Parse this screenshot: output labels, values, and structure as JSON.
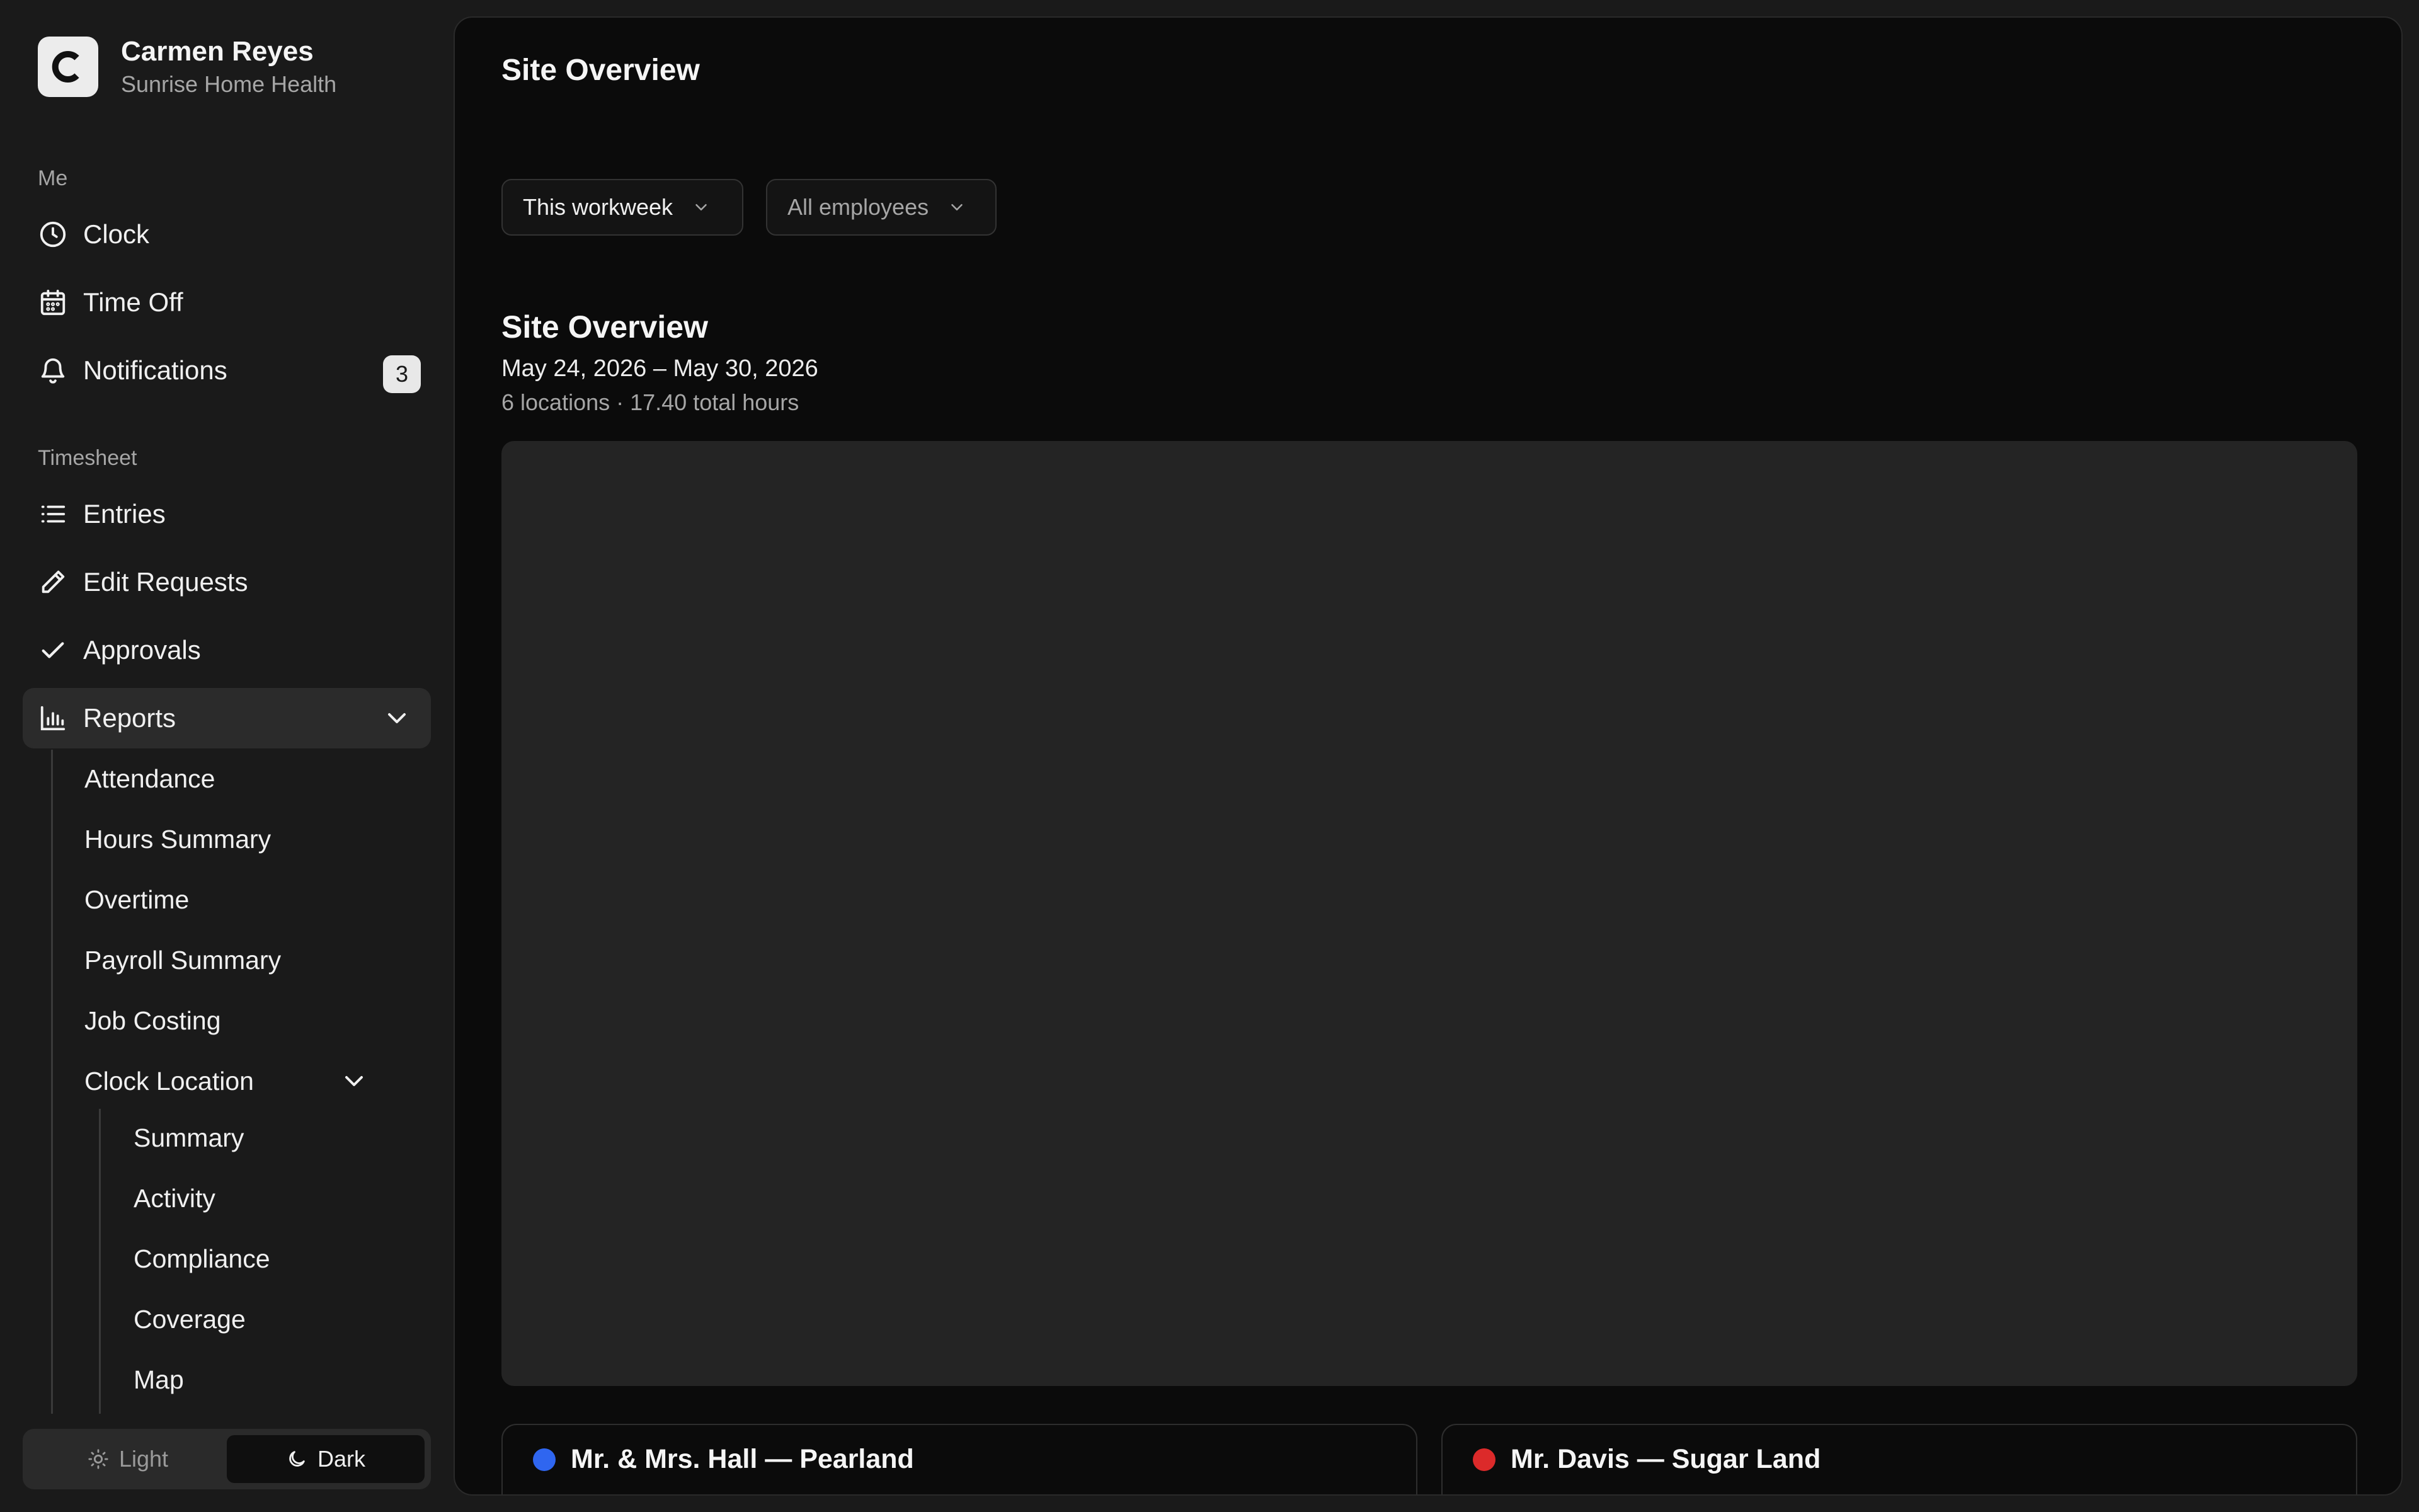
{
  "profile": {
    "name": "Carmen Reyes",
    "org": "Sunrise Home Health",
    "logo_letter": "C"
  },
  "sections": {
    "me": "Me",
    "timesheet": "Timesheet"
  },
  "me_items": [
    {
      "label": "Clock",
      "icon": "clock-icon"
    },
    {
      "label": "Time Off",
      "icon": "calendar-icon"
    },
    {
      "label": "Notifications",
      "icon": "bell-icon",
      "badge": "3"
    }
  ],
  "timesheet_items": [
    {
      "label": "Entries",
      "icon": "list-icon"
    },
    {
      "label": "Edit Requests",
      "icon": "pencil-icon"
    },
    {
      "label": "Approvals",
      "icon": "check-icon"
    },
    {
      "label": "Reports",
      "icon": "bar-chart-icon",
      "expanded": true
    }
  ],
  "reports_items": [
    "Attendance",
    "Hours Summary",
    "Overtime",
    "Payroll Summary",
    "Job Costing",
    "Clock Location"
  ],
  "clock_location_items": [
    "Summary",
    "Activity",
    "Compliance",
    "Coverage",
    "Map"
  ],
  "theme": {
    "light": "Light",
    "dark": "Dark",
    "selected": "Dark"
  },
  "main": {
    "title": "Site Overview",
    "filters": {
      "period": "This workweek",
      "employees": "All employees"
    },
    "overview": {
      "title": "Site Overview",
      "dates": "May 24, 2026 – May 30, 2026",
      "meta": "6 locations · 17.40 total hours"
    },
    "locations": [
      {
        "name": "Mr. & Mrs. Hall — Pearland",
        "color": "#2f66f0"
      },
      {
        "name": "Mr. Davis — Sugar Land",
        "color": "#dc2a2a"
      }
    ]
  }
}
